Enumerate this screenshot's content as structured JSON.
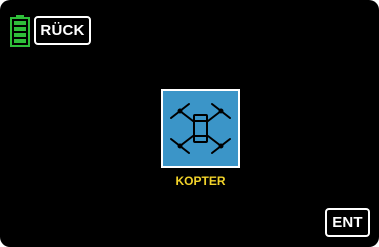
{
  "header": {
    "battery_icon": "battery-icon",
    "back_label": "RÜCK"
  },
  "main": {
    "model_icon": "quadcopter-icon",
    "model_label": "KOPTER"
  },
  "footer": {
    "enter_label": "ENT"
  },
  "colors": {
    "background": "#000000",
    "tile": "#3b95c8",
    "label": "#f2d32a",
    "battery": "#2fbf3a"
  }
}
